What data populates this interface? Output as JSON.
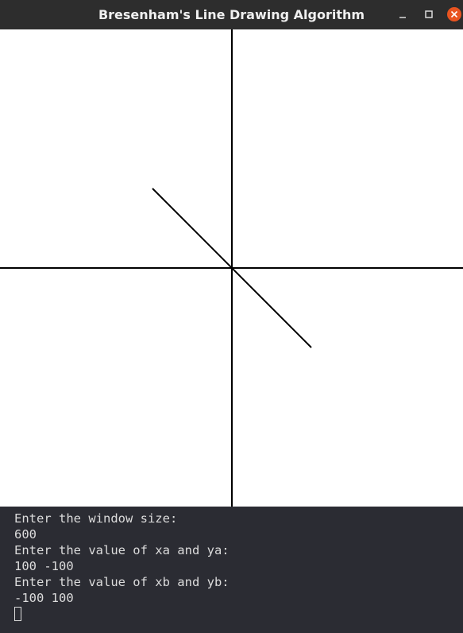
{
  "window": {
    "title": "Bresenham's Line Drawing Algorithm"
  },
  "drawing": {
    "window_size": 600,
    "line": {
      "xa": 100,
      "ya": -100,
      "xb": -100,
      "yb": 100
    },
    "colors": {
      "background": "#ffffff",
      "axis": "#000000",
      "line": "#000000"
    }
  },
  "terminal": {
    "lines": [
      "Enter the window size:",
      "600",
      "Enter the value of xa and ya:",
      "100 -100",
      "Enter the value of xb and yb:",
      "-100 100"
    ]
  },
  "colors": {
    "titlebar": "#2d2d2d",
    "terminal_bg": "#2b2c33",
    "terminal_text": "#dcdcdc",
    "close_button": "#e95420"
  }
}
